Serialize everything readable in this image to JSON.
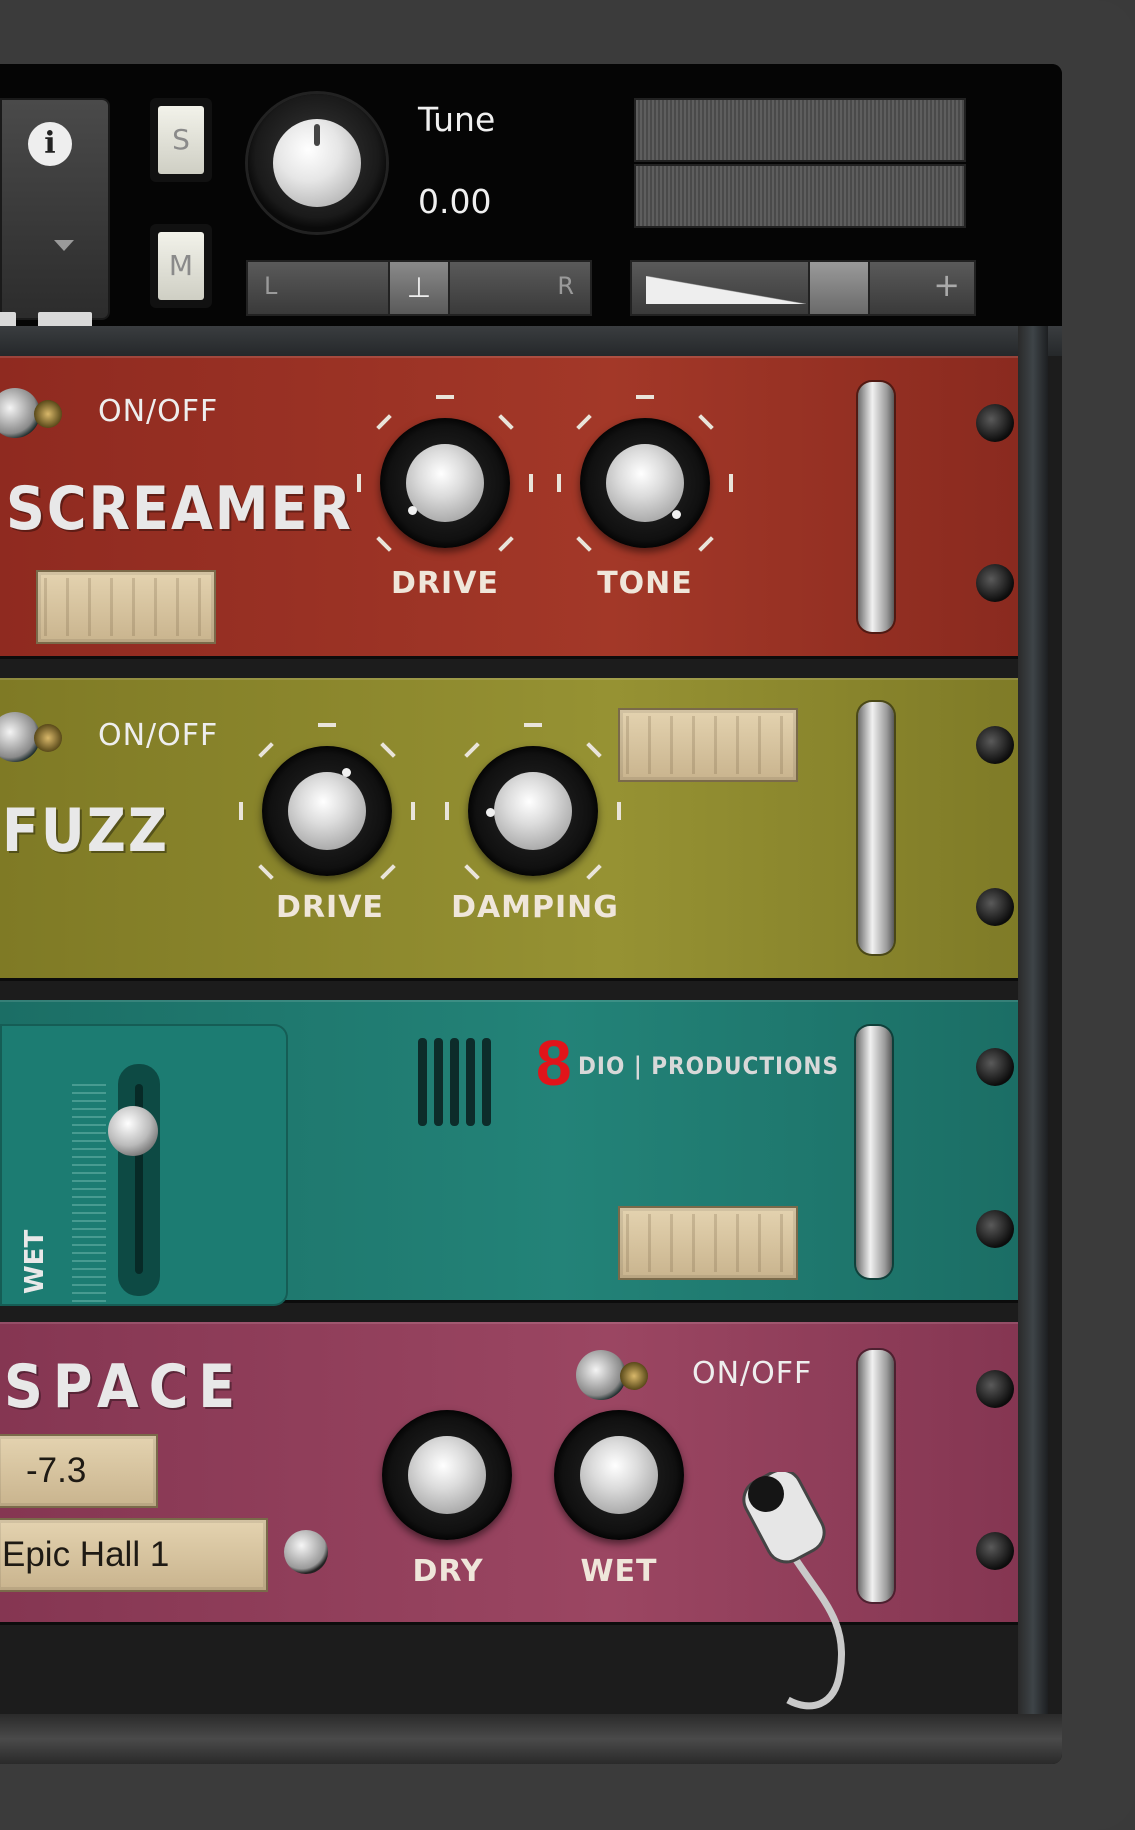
{
  "header": {
    "info_icon": "info-icon",
    "solo_label": "S",
    "mute_label": "M",
    "tune_label": "Tune",
    "tune_value": "0.00",
    "pan_left": "L",
    "pan_right": "R",
    "vol_minus": "-",
    "vol_plus": "+"
  },
  "modules": {
    "screamer": {
      "onoff_label": "ON/OFF",
      "title": "SCREAMER",
      "knob1_label": "DRIVE",
      "knob2_label": "TONE",
      "color": "#9a2f24"
    },
    "fuzz": {
      "onoff_label": "ON/OFF",
      "title": "FUZZ",
      "knob1_label": "DRIVE",
      "knob2_label": "DAMPING",
      "color": "#8d8a2d"
    },
    "delay": {
      "logo_mark": "8",
      "logo_text": "DIO | PRODUCTIONS",
      "slider_label": "WET",
      "color": "#1f7a70"
    },
    "space": {
      "title": "SPACE",
      "onoff_label": "ON/OFF",
      "value_display": "-7.3",
      "preset_display": "Epic Hall 1",
      "knob1_label": "DRY",
      "knob2_label": "WET",
      "color": "#8e3d57"
    }
  }
}
